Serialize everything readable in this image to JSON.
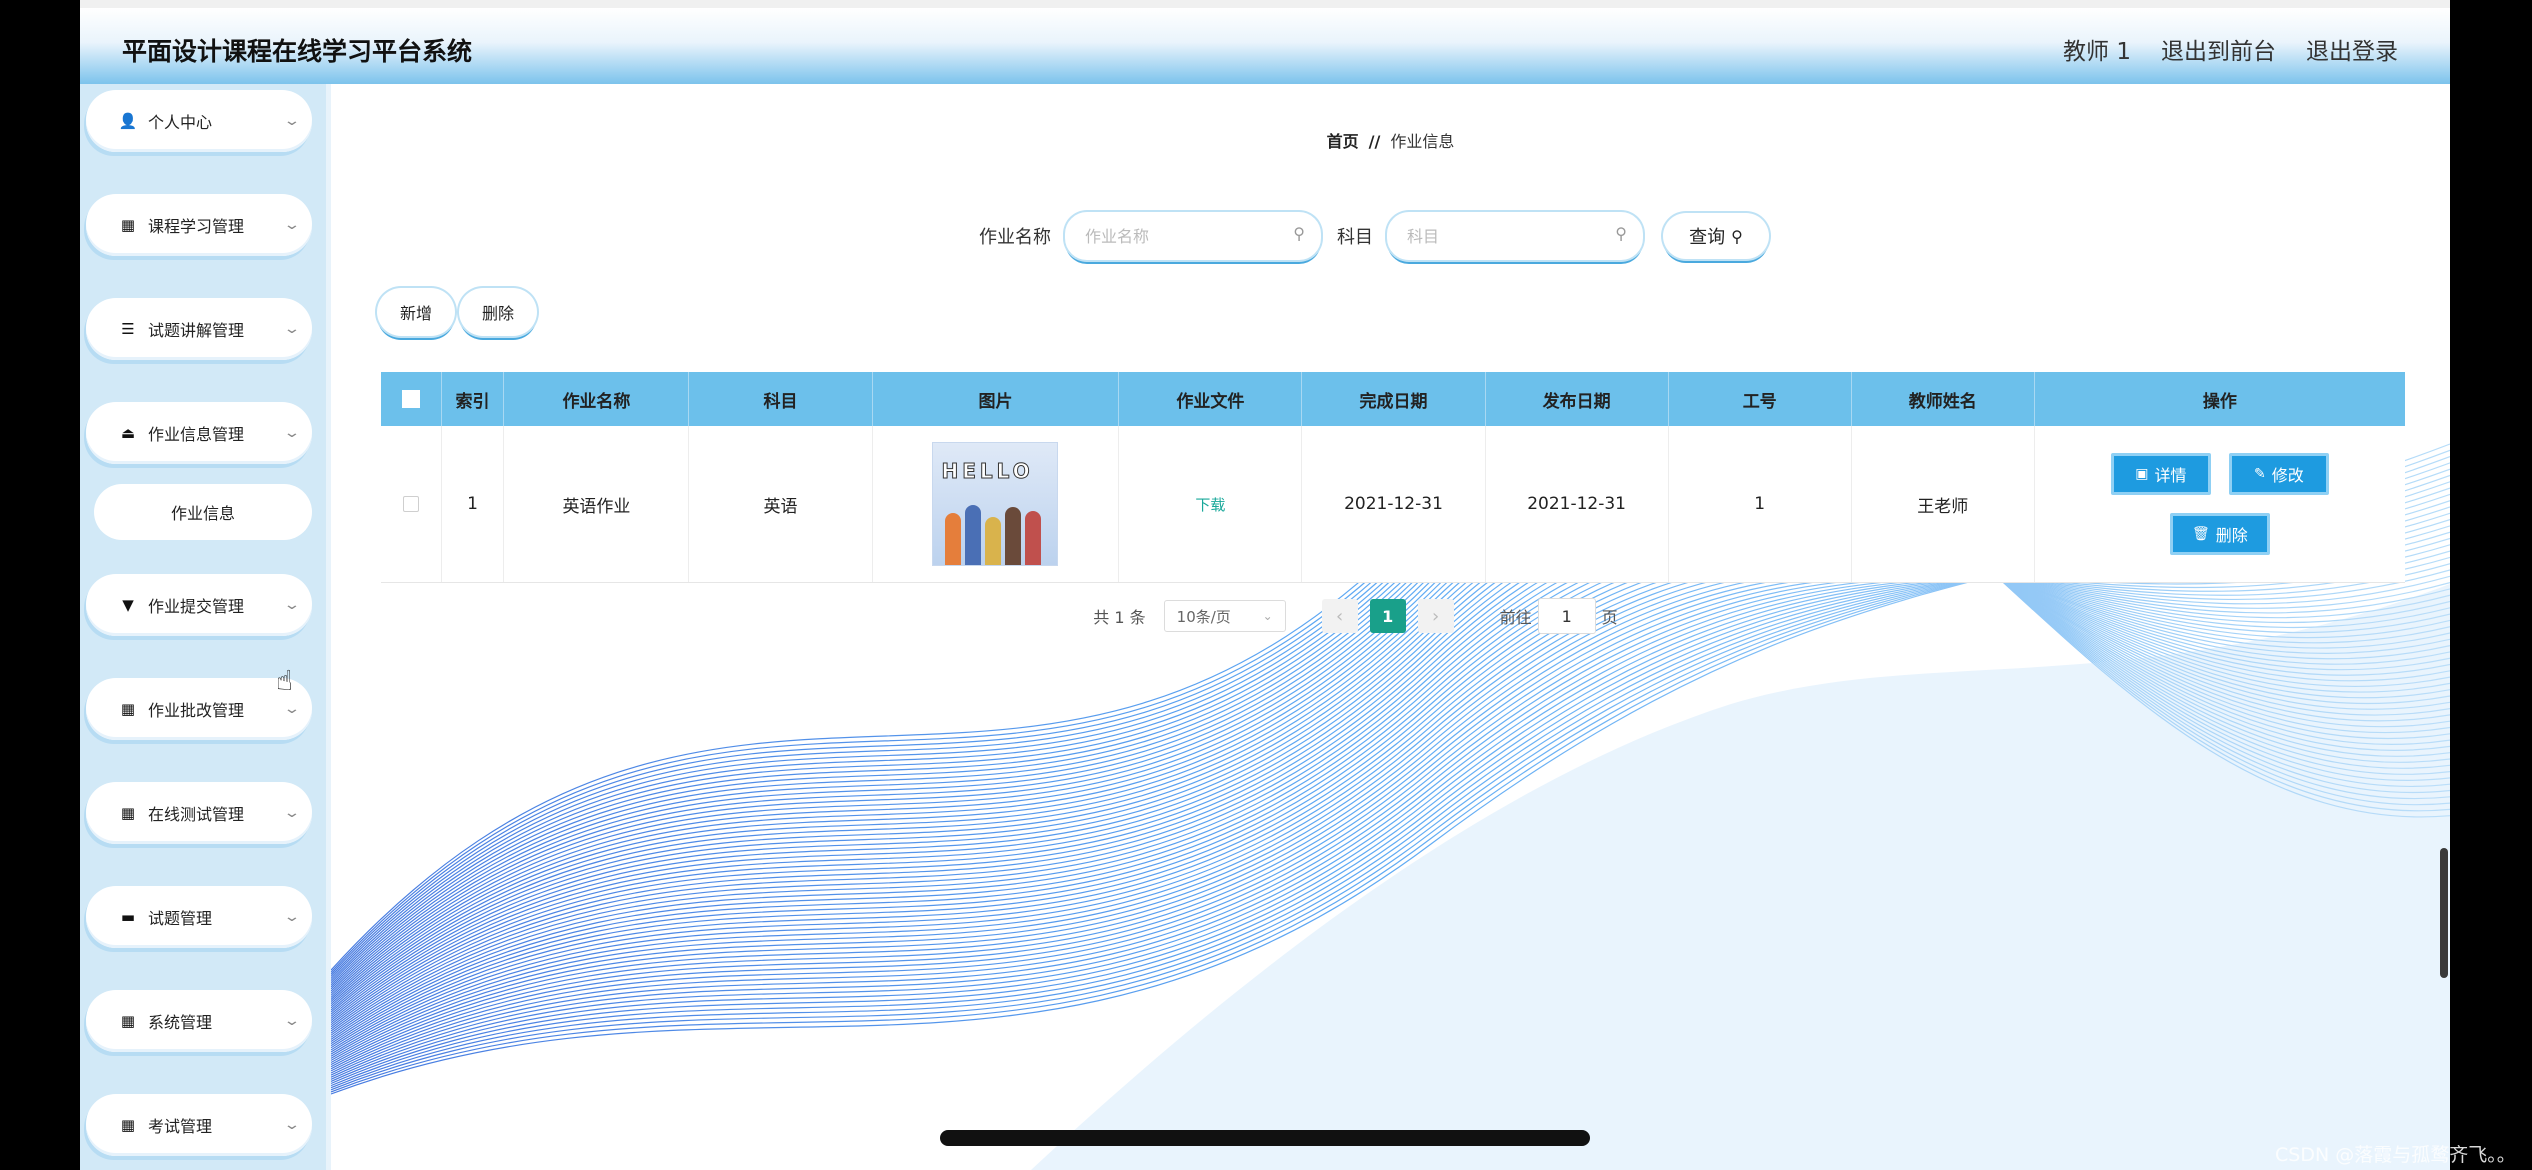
{
  "app": {
    "title": "平面设计课程在线学习平台系统",
    "header_links": [
      "教师 1",
      "退出到前台",
      "退出登录"
    ]
  },
  "sidebar": {
    "items": [
      {
        "label": "个人中心",
        "icon": "user-icon",
        "glyph": "👤"
      },
      {
        "label": "课程学习管理",
        "icon": "grid-icon",
        "glyph": "▦"
      },
      {
        "label": "试题讲解管理",
        "icon": "list-icon",
        "glyph": "☰"
      },
      {
        "label": "作业信息管理",
        "icon": "person-stand-icon",
        "glyph": "⏏"
      },
      {
        "label": "作业提交管理",
        "icon": "stamp-icon",
        "glyph": "▼"
      },
      {
        "label": "作业批改管理",
        "icon": "grid-icon",
        "glyph": "▦"
      },
      {
        "label": "在线测试管理",
        "icon": "grid-icon",
        "glyph": "▦"
      },
      {
        "label": "试题管理",
        "icon": "monitor-icon",
        "glyph": "▬"
      },
      {
        "label": "系统管理",
        "icon": "grid-icon",
        "glyph": "▦"
      },
      {
        "label": "考试管理",
        "icon": "grid-icon",
        "glyph": "▦"
      }
    ],
    "submenu": {
      "label": "作业信息"
    }
  },
  "breadcrumb": {
    "home": "首页",
    "separator": "//",
    "current": "作业信息"
  },
  "search": {
    "name_label": "作业名称",
    "name_placeholder": "作业名称",
    "subject_label": "科目",
    "subject_placeholder": "科目",
    "query_label": "查询"
  },
  "actions": {
    "add_label": "新增",
    "delete_label": "删除"
  },
  "table": {
    "columns": [
      "索引",
      "作业名称",
      "科目",
      "图片",
      "作业文件",
      "完成日期",
      "发布日期",
      "工号",
      "教师姓名",
      "操作"
    ],
    "rows": [
      {
        "index": "1",
        "name": "英语作业",
        "subject": "英语",
        "image_text": "HELLO",
        "file_link": "下载",
        "finish_date": "2021-12-31",
        "publish_date": "2021-12-31",
        "job_no": "1",
        "teacher": "王老师",
        "ops": {
          "detail": "详情",
          "edit": "修改",
          "delete": "删除"
        }
      }
    ]
  },
  "pagination": {
    "total_text": "共 1 条",
    "page_size": "10条/页",
    "current_page": "1",
    "goto_prefix": "前往",
    "goto_value": "1",
    "goto_suffix": "页"
  },
  "watermark": "CSDN @落霞与孤鹜齐飞。。",
  "colors": {
    "header_blue": "#7cc3ec",
    "table_head": "#6cc0eb",
    "primary_btn": "#1e9be0",
    "pager_active": "#19a08a",
    "sidebar_bg": "#d2e9f7"
  }
}
